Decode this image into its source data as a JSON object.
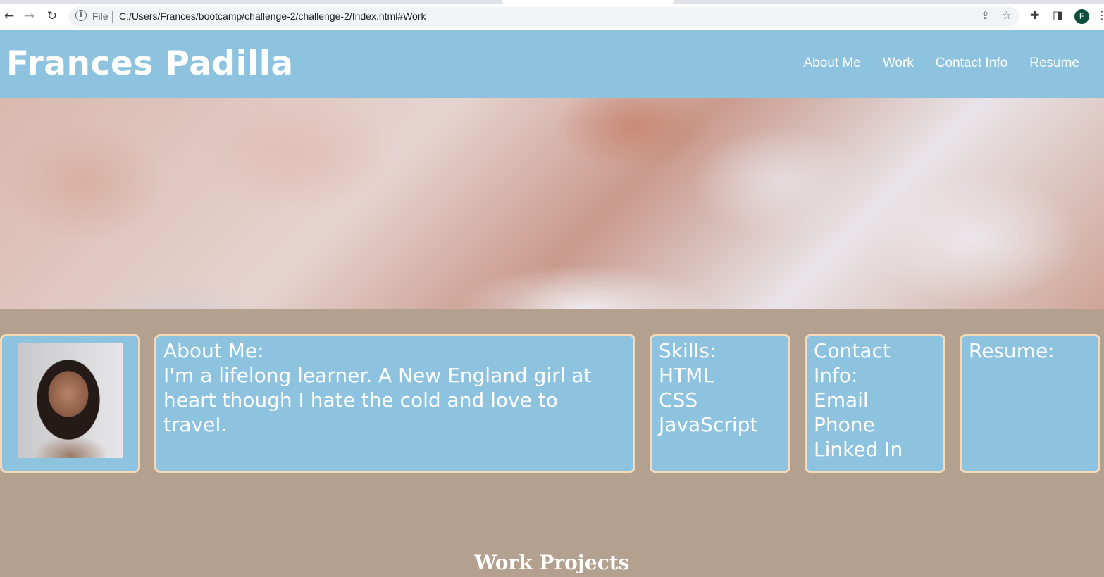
{
  "browser": {
    "scheme_label": "File",
    "url": "C:/Users/Frances/bootcamp/challenge-2/challenge-2/Index.html#Work",
    "profile_initial": "F"
  },
  "header": {
    "title": "Frances Padilla",
    "nav": [
      "About Me",
      "Work",
      "Contact Info",
      "Resume"
    ]
  },
  "about": {
    "heading": "About Me:",
    "text": "I'm a lifelong learner. A New England girl at heart though I hate the cold and love to travel."
  },
  "skills": {
    "heading": "Skills:",
    "items": [
      "HTML",
      "CSS",
      "JavaScript"
    ]
  },
  "contact": {
    "heading": "Contact Info:",
    "items": [
      "Email",
      "Phone",
      "Linked In"
    ]
  },
  "resume": {
    "heading": "Resume:"
  },
  "work": {
    "heading": "Work Projects"
  },
  "colors": {
    "header_bg": "#8ec3df",
    "page_bg": "#b3a08f",
    "card_border": "#f6d9b8"
  }
}
